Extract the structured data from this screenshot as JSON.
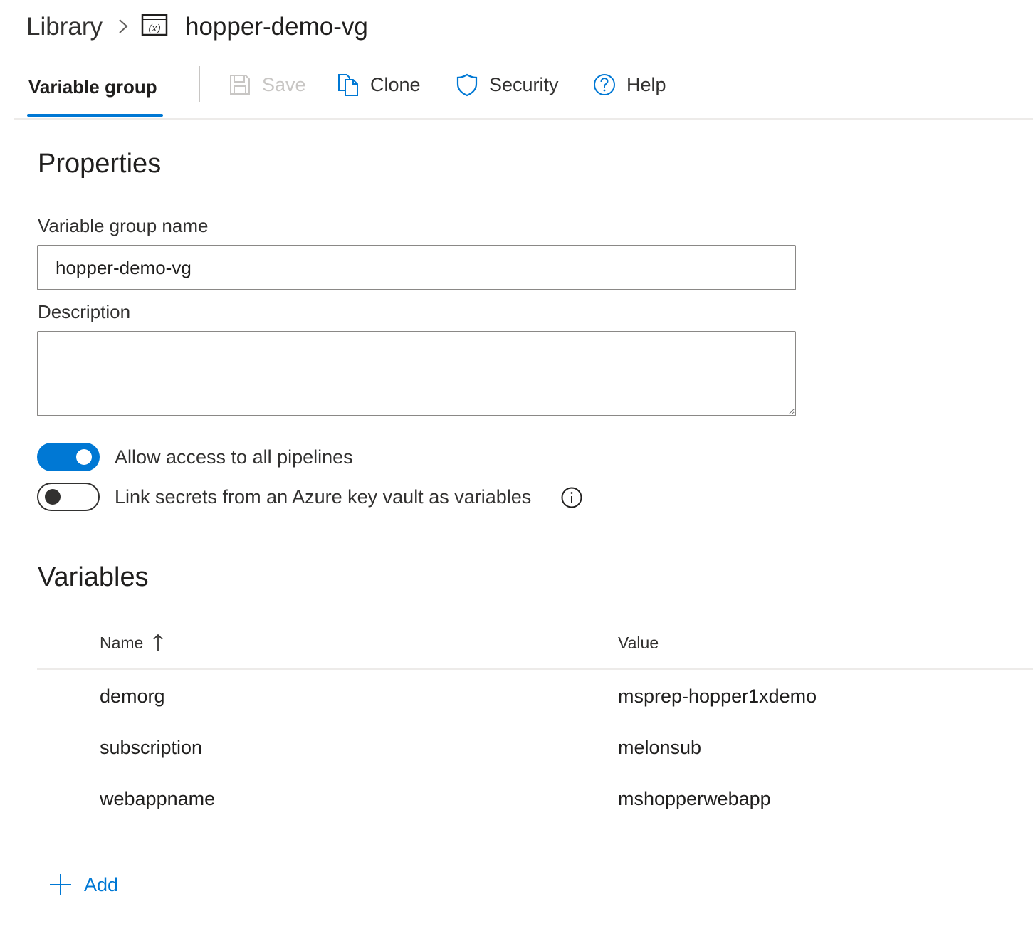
{
  "breadcrumb": {
    "root": "Library",
    "current": "hopper-demo-vg",
    "vg_icon": "variable-group-icon"
  },
  "toolbar": {
    "tab_label": "Variable group",
    "save_label": "Save",
    "clone_label": "Clone",
    "security_label": "Security",
    "help_label": "Help"
  },
  "properties": {
    "title": "Properties",
    "name_label": "Variable group name",
    "name_value": "hopper-demo-vg",
    "description_label": "Description",
    "description_value": "",
    "allow_pipelines_label": "Allow access to all pipelines",
    "allow_pipelines_on": true,
    "link_keyvault_label": "Link secrets from an Azure key vault as variables",
    "link_keyvault_on": false
  },
  "variables": {
    "title": "Variables",
    "columns": {
      "name": "Name",
      "value": "Value"
    },
    "rows": [
      {
        "name": "demorg",
        "value": "msprep-hopper1xdemo"
      },
      {
        "name": "subscription",
        "value": "melonsub"
      },
      {
        "name": "webappname",
        "value": "mshopperwebapp"
      }
    ],
    "add_label": "Add"
  },
  "colors": {
    "accent": "#0078d4",
    "disabled": "#c8c6c4",
    "text": "#201f1e"
  }
}
